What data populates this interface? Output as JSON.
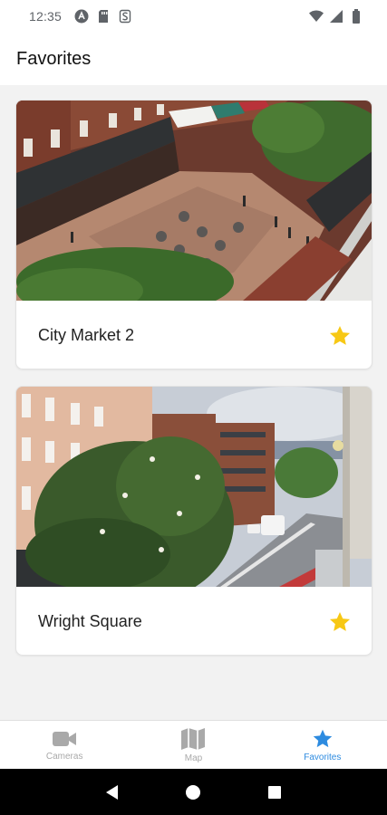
{
  "status_bar": {
    "time": "12:35"
  },
  "header": {
    "title": "Favorites"
  },
  "cards": [
    {
      "title": "City Market 2",
      "favorited": true,
      "star_color": "#f7c815"
    },
    {
      "title": "Wright Square",
      "favorited": true,
      "star_color": "#f7c815"
    }
  ],
  "bottom_nav": {
    "items": [
      {
        "label": "Cameras",
        "icon": "video-camera-icon",
        "active": false
      },
      {
        "label": "Map",
        "icon": "map-icon",
        "active": false
      },
      {
        "label": "Favorites",
        "icon": "star-icon",
        "active": true
      }
    ],
    "active_color": "#2d8be0",
    "inactive_color": "#a9a9a9"
  },
  "system_nav": {
    "buttons": [
      "back",
      "home",
      "recents"
    ]
  }
}
